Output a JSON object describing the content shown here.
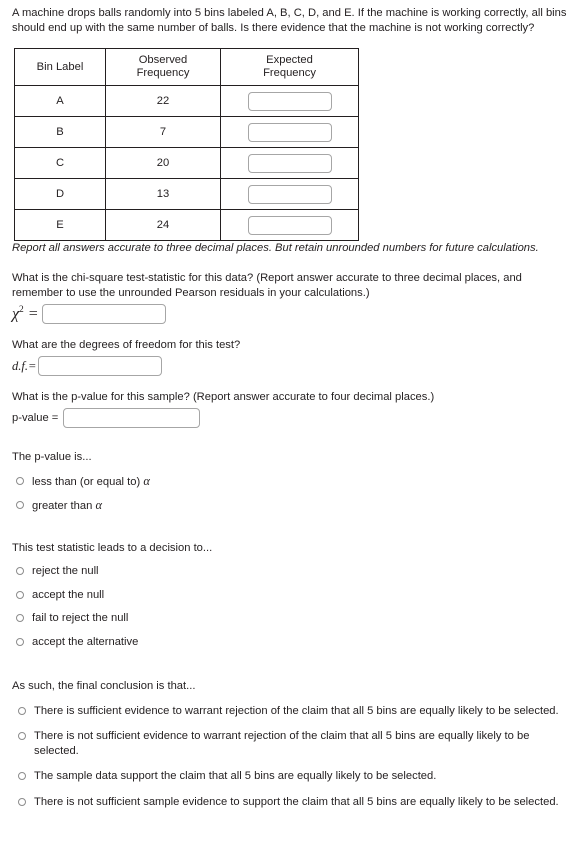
{
  "intro": {
    "text": "A machine drops balls randomly into 5 bins labeled A, B, C, D, and E. If the machine is working correctly, all bins should end up with the same number of balls. Is there evidence that the machine is not working correctly?"
  },
  "table": {
    "headers": {
      "bin_label": "Bin Label",
      "observed_line1": "Observed",
      "observed_line2": "Frequency",
      "expected_line1": "Expected",
      "expected_line2": "Frequency"
    },
    "rows": [
      {
        "bin": "A",
        "observed": "22",
        "expected_value": ""
      },
      {
        "bin": "B",
        "observed": "7",
        "expected_value": ""
      },
      {
        "bin": "C",
        "observed": "20",
        "expected_value": ""
      },
      {
        "bin": "D",
        "observed": "13",
        "expected_value": ""
      },
      {
        "bin": "E",
        "observed": "24",
        "expected_value": ""
      }
    ]
  },
  "note": {
    "text": "Report all answers accurate to three decimal places. But retain unrounded numbers for future calculations."
  },
  "chi_square": {
    "question": "What is the chi-square test-statistic for this data? (Report answer accurate to three decimal places, and remember to use the unrounded Pearson residuals in your calculations.)",
    "symbol": "χ",
    "exponent": "2",
    "equals": "=",
    "value": ""
  },
  "degrees_of_freedom": {
    "question": "What are the degrees of freedom for this test?",
    "label": "d.f.=",
    "value": ""
  },
  "p_value": {
    "question": "What is the p-value for this sample? (Report answer accurate to four decimal places.)",
    "label": "p-value =",
    "value": ""
  },
  "p_value_is": {
    "heading": "The p-value is...",
    "options": [
      {
        "text_before": "less than (or equal to) ",
        "symbol": "α",
        "selected": false
      },
      {
        "text_before": "greater than ",
        "symbol": "α",
        "selected": false
      }
    ]
  },
  "decision": {
    "heading": "This test statistic leads to a decision to...",
    "options": [
      {
        "label": "reject the null",
        "selected": false
      },
      {
        "label": "accept the null",
        "selected": false
      },
      {
        "label": "fail to reject the null",
        "selected": false
      },
      {
        "label": "accept the alternative",
        "selected": false
      }
    ]
  },
  "conclusion": {
    "heading": "As such, the final conclusion is that...",
    "options": [
      {
        "label": "There is sufficient evidence to warrant rejection of the claim that all 5 bins are equally likely to be selected.",
        "selected": false
      },
      {
        "label": "There is not sufficient evidence to warrant rejection of the claim that all 5 bins are equally likely to be selected.",
        "selected": false
      },
      {
        "label": "The sample data support the claim that all 5 bins are equally likely to be selected.",
        "selected": false
      },
      {
        "label": "There is not sufficient sample evidence to support the claim that all 5 bins are equally likely to be selected.",
        "selected": false
      }
    ]
  }
}
